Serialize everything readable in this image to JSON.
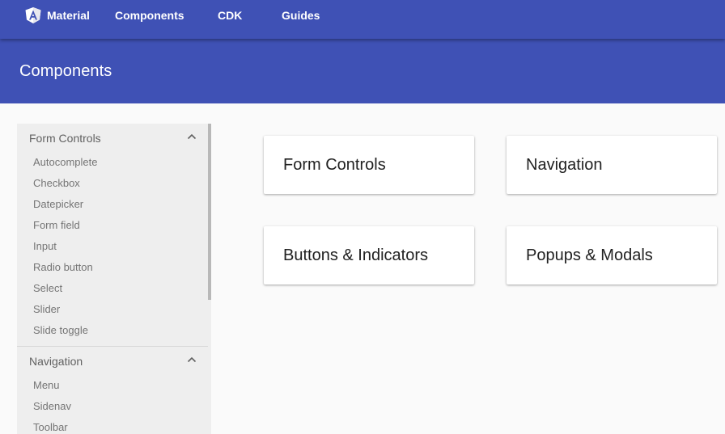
{
  "topnav": {
    "brand_label": "Material",
    "logo_icon": "angular-logo-icon",
    "links": [
      "Components",
      "CDK",
      "Guides"
    ]
  },
  "header": {
    "title": "Components"
  },
  "sidebar": {
    "sections": [
      {
        "title": "Form Controls",
        "expanded": true,
        "items": [
          "Autocomplete",
          "Checkbox",
          "Datepicker",
          "Form field",
          "Input",
          "Radio button",
          "Select",
          "Slider",
          "Slide toggle"
        ]
      },
      {
        "title": "Navigation",
        "expanded": true,
        "items": [
          "Menu",
          "Sidenav",
          "Toolbar"
        ]
      }
    ]
  },
  "main": {
    "categories": [
      "Form Controls",
      "Navigation",
      "Buttons & Indicators",
      "Popups & Modals"
    ]
  },
  "colors": {
    "primary": "#3f51b5",
    "background": "#fafafa",
    "sidebar": "#eeeeee",
    "card": "#ffffff"
  }
}
